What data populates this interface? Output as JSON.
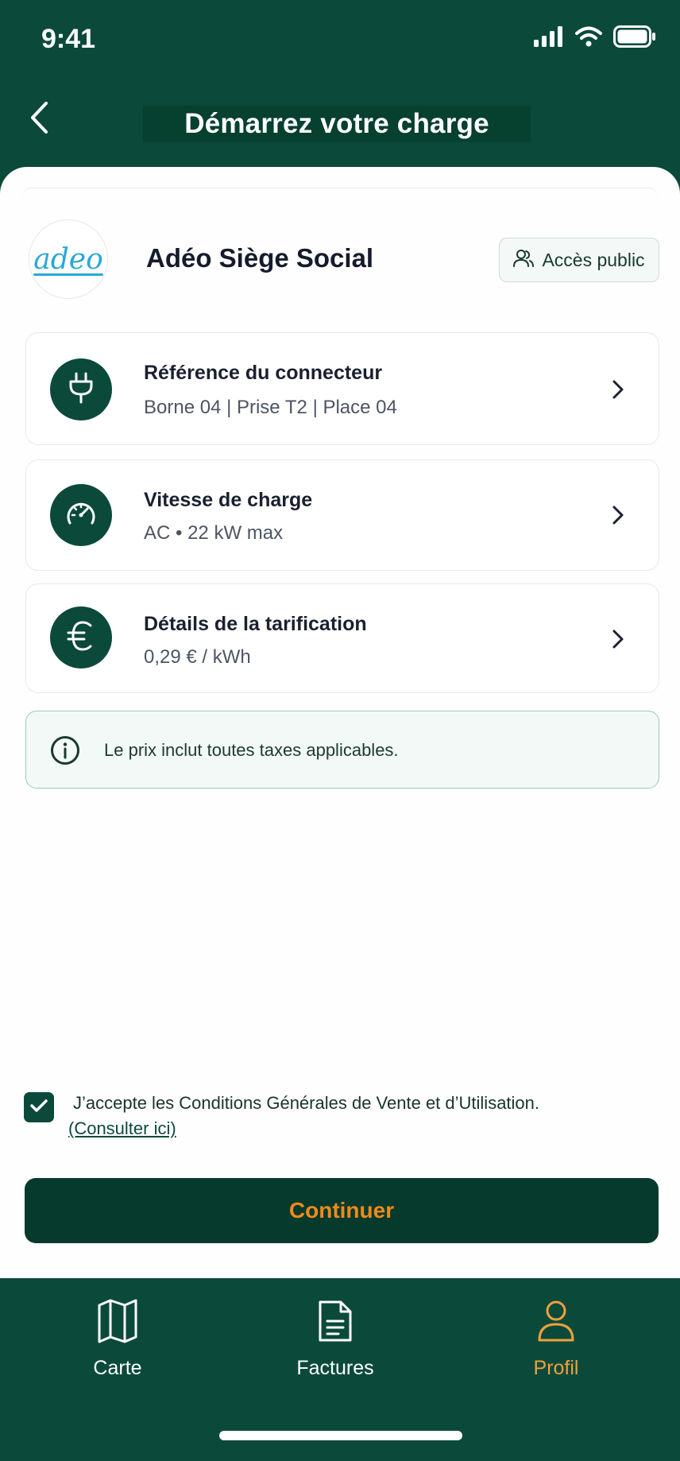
{
  "status_bar": {
    "time": "9:41"
  },
  "header": {
    "title": "Démarrez votre charge"
  },
  "station": {
    "logo_text": "adeo",
    "name": "Adéo Siège Social",
    "access_label": "Accès public"
  },
  "cards": [
    {
      "title": "Référence du connecteur",
      "subtitle": "Borne 04 | Prise T2 | Place 04",
      "icon": "plug-icon"
    },
    {
      "title": "Vitesse de charge",
      "subtitle": "AC • 22 kW max",
      "icon": "speedometer-icon"
    },
    {
      "title": "Détails de la tarification",
      "subtitle": "0,29 € / kWh",
      "icon": "euro-icon"
    }
  ],
  "info": {
    "text": "Le prix inclut toutes taxes applicables."
  },
  "terms": {
    "text": "J’accepte les Conditions Générales de Vente et d’Utilisation.",
    "link": "(Consulter ici)",
    "checked": true
  },
  "cta": {
    "label": "Continuer"
  },
  "tabbar": {
    "items": [
      {
        "label": "Carte",
        "icon": "map-icon",
        "active": false
      },
      {
        "label": "Factures",
        "icon": "invoice-icon",
        "active": false
      },
      {
        "label": "Profil",
        "icon": "user-icon",
        "active": true
      }
    ]
  },
  "colors": {
    "brand": "#0b4a3b",
    "accent": "#f08a1c",
    "logo": "#29a8d8"
  }
}
